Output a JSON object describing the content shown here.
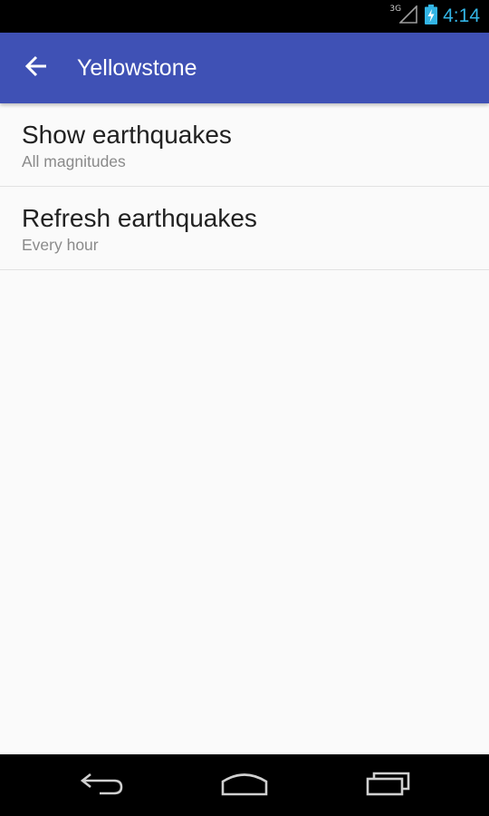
{
  "status_bar": {
    "network": "3G",
    "time": "4:14",
    "icons": [
      "signal-icon",
      "battery-charging-icon"
    ]
  },
  "app_bar": {
    "title": "Yellowstone",
    "back_icon": "arrow-back-icon",
    "color": "#3f51b5"
  },
  "preferences": [
    {
      "title": "Show earthquakes",
      "summary": "All magnitudes"
    },
    {
      "title": "Refresh earthquakes",
      "summary": "Every hour"
    }
  ],
  "nav_bar": {
    "buttons": [
      "back-icon",
      "home-icon",
      "recent-apps-icon"
    ]
  },
  "colors": {
    "accent_clock": "#33b5e5",
    "background": "#fafafa"
  }
}
